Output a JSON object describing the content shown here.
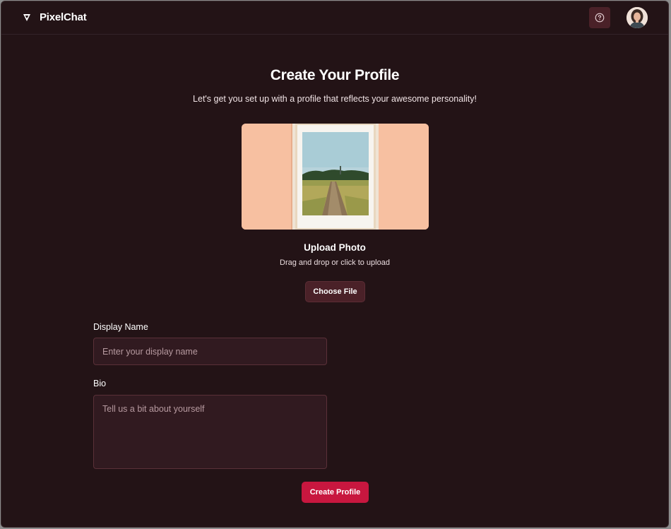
{
  "app": {
    "name": "PixelChat",
    "logo_icon": "triangle-logo-icon"
  },
  "header": {
    "help_icon": "question-circle-icon",
    "avatar": "user-avatar"
  },
  "main": {
    "title": "Create Your Profile",
    "subtitle": "Let's get you set up with a profile that reflects your awesome personality!",
    "upload": {
      "heading": "Upload Photo",
      "hint": "Drag and drop or click to upload",
      "button_label": "Choose File"
    },
    "form": {
      "display_name": {
        "label": "Display Name",
        "placeholder": "Enter your display name",
        "value": ""
      },
      "bio": {
        "label": "Bio",
        "placeholder": "Tell us a bit about yourself",
        "value": ""
      },
      "submit_label": "Create Profile"
    }
  },
  "colors": {
    "background": "#231316",
    "surface": "#311a20",
    "accent": "#c8173f",
    "secondary_button": "#4a2128"
  }
}
